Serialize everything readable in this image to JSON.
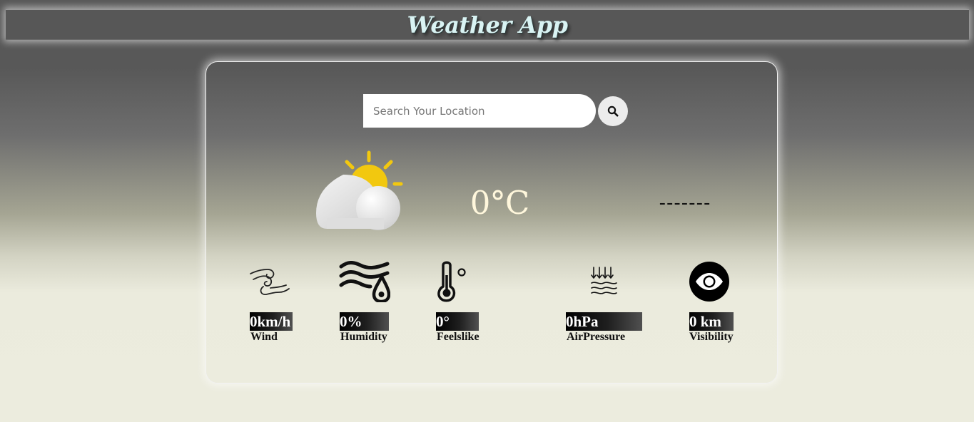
{
  "header": {
    "title": "Weather App"
  },
  "search": {
    "placeholder": "Search Your Location",
    "button_icon": "search-icon"
  },
  "current": {
    "icon": "partly-cloudy-icon",
    "temperature": "0°C",
    "condition": "-------"
  },
  "stats": [
    {
      "icon": "wind-icon",
      "value": "0km/h",
      "label": "Wind"
    },
    {
      "icon": "humidity-icon",
      "value": "0%",
      "label": "Humidity"
    },
    {
      "icon": "thermometer-icon",
      "value": "0°",
      "label": "Feelslike"
    },
    {
      "icon": "air-pressure-icon",
      "value": "0hPa",
      "label": "AirPressure"
    },
    {
      "icon": "eye-icon",
      "value": "0 km",
      "label": "Visibility"
    }
  ],
  "colors": {
    "header_bg": "#575757",
    "title_color": "#d9f3f3",
    "sun_yellow": "#f2c80f",
    "temperature_color": "#fff7dc",
    "stat_value_bg": "#000000"
  }
}
